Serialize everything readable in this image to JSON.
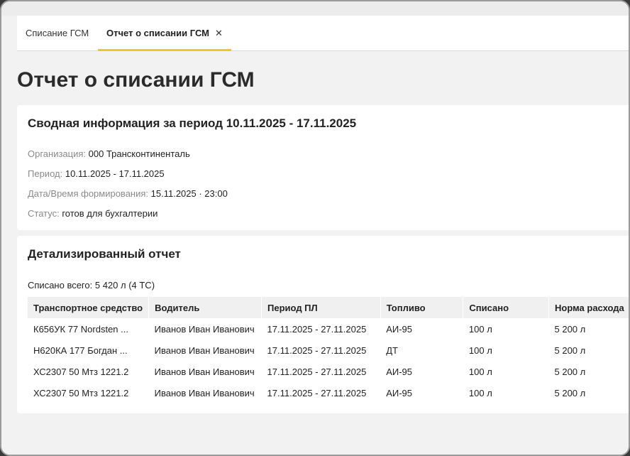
{
  "tabs": [
    {
      "label": "Списание ГСМ"
    },
    {
      "label": "Отчет о списании ГСМ",
      "close": "✕"
    }
  ],
  "page_title": "Отчет о списании ГСМ",
  "summary": {
    "title": "Сводная информация за период 10.11.2025 - 17.11.2025",
    "organization_label": "Организация:",
    "organization_value": "000 Трансконтиненталь",
    "period_label": "Период:",
    "period_value": "10.11.2025 - 17.11.2025",
    "generated_label": "Дата/Время формирования:",
    "generated_value": "15.11.2025 · 23:00",
    "status_label": "Статус:",
    "status_value": "готов для бухгалтерии"
  },
  "detail": {
    "title": "Детализированный отчет",
    "total_label": "Списано всего:",
    "total_value": "5 420 л (4 ТС)",
    "columns": [
      "Транспортное средство",
      "Водитель",
      "Период ПЛ",
      "Топливо",
      "Списано",
      "Норма расхода"
    ],
    "rows": [
      [
        "К656УК 77 Nordsten ...",
        "Иванов Иван Иванович",
        "17.11.2025 - 27.11.2025",
        "АИ-95",
        "100 л",
        "5 200 л"
      ],
      [
        "Н620КА 177 Богдан ...",
        "Иванов Иван Иванович",
        "17.11.2025 - 27.11.2025",
        "ДТ",
        "100 л",
        "5 200 л"
      ],
      [
        "ХС2307 50 Мтз 1221.2",
        "Иванов Иван Иванович",
        "17.11.2025 - 27.11.2025",
        "АИ-95",
        "100 л",
        "5 200 л"
      ],
      [
        "ХС2307 50 Мтз 1221.2",
        "Иванов Иван Иванович",
        "17.11.2025 - 27.11.2025",
        "АИ-95",
        "100 л",
        "5 200 л"
      ]
    ]
  },
  "colors": {
    "accent": "#f2c230",
    "label_gray": "#8a8a8a",
    "header_bg": "#f0f0f0"
  }
}
